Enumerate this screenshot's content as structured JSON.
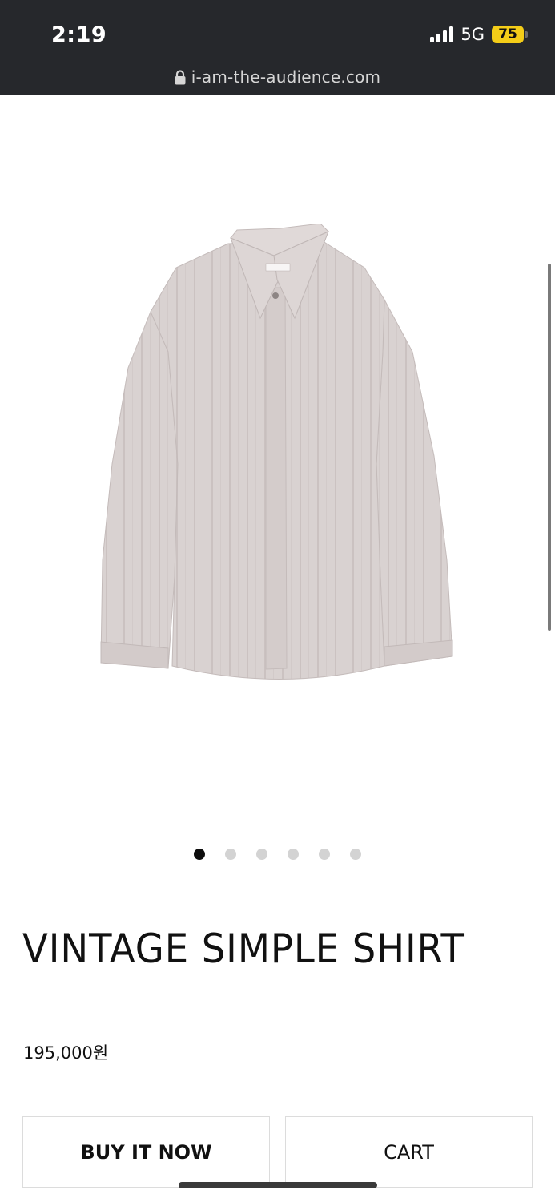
{
  "status_bar": {
    "time": "2:19",
    "network": "5G",
    "battery": "75",
    "icons": [
      "signal-icon",
      "battery-icon"
    ],
    "battery_color": "#f4cd18"
  },
  "url_bar": {
    "url": "i-am-the-audience.com",
    "icon": "lock-icon"
  },
  "product": {
    "title": "VINTAGE SIMPLE SHIRT",
    "price": "195,000원",
    "gallery": {
      "current_index": 1,
      "total": 6
    }
  },
  "actions": {
    "buy_label": "BUY IT NOW",
    "cart_label": "CART"
  },
  "colors": {
    "top_bar": "#26282c",
    "shirt": "#d8d1d0",
    "dot_active": "#0d0d0d",
    "dot_inactive": "#d3d3d3"
  }
}
